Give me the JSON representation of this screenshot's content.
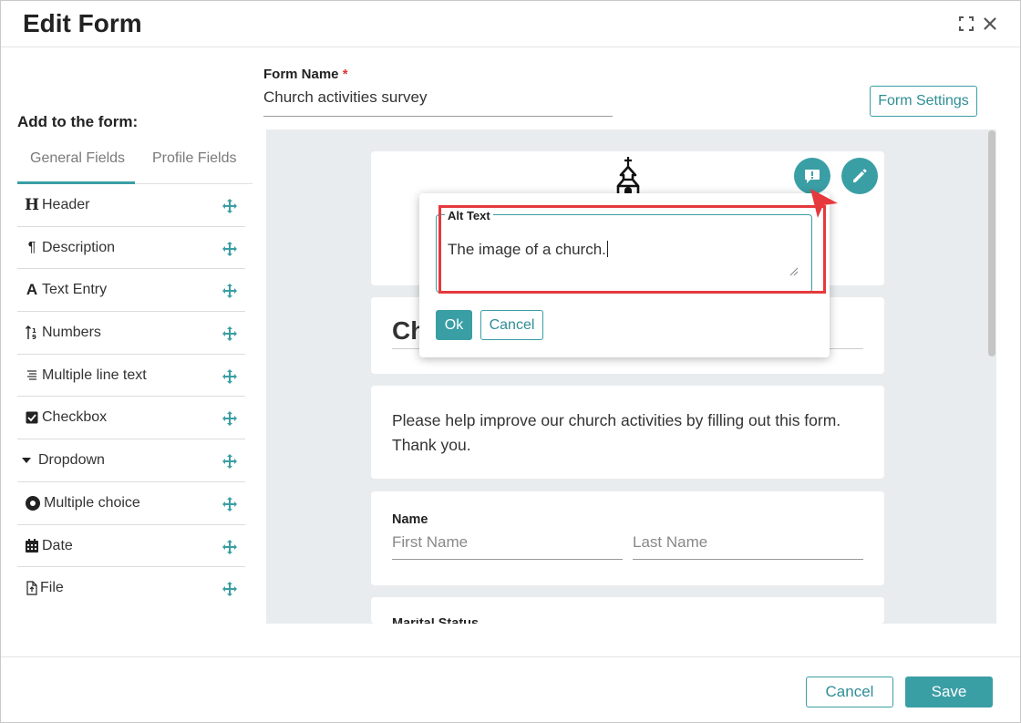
{
  "dialog": {
    "title": "Edit Form",
    "icons": {
      "fullscreen": "fullscreen-icon",
      "close": "close-icon"
    }
  },
  "sidebar": {
    "title": "Add to the form:",
    "tabs": [
      {
        "label": "General Fields",
        "active": true
      },
      {
        "label": "Profile Fields",
        "active": false
      }
    ],
    "items": [
      {
        "label": "Header",
        "icon": "header-icon"
      },
      {
        "label": "Description",
        "icon": "paragraph-icon"
      },
      {
        "label": "Text Entry",
        "icon": "text-icon"
      },
      {
        "label": "Numbers",
        "icon": "numbers-icon"
      },
      {
        "label": "Multiple line text",
        "icon": "multiline-icon"
      },
      {
        "label": "Checkbox",
        "icon": "checkbox-icon"
      },
      {
        "label": "Dropdown",
        "icon": "caret-down-icon"
      },
      {
        "label": "Multiple choice",
        "icon": "radio-icon"
      },
      {
        "label": "Date",
        "icon": "calendar-icon"
      },
      {
        "label": "File",
        "icon": "file-icon"
      }
    ]
  },
  "form": {
    "name_label": "Form Name",
    "required_mark": "*",
    "name_value": "Church activities survey",
    "settings_label": "Form Settings"
  },
  "canvas": {
    "header_text": "Ch",
    "description": "Please help improve our church activities by filling out this form. Thank you.",
    "name_field": {
      "label": "Name",
      "first_placeholder": "First Name",
      "last_placeholder": "Last Name"
    },
    "marital_label": "Marital Status"
  },
  "alt_popover": {
    "legend": "Alt Text",
    "value": "The image of a church.",
    "ok_label": "Ok",
    "cancel_label": "Cancel"
  },
  "footer": {
    "cancel_label": "Cancel",
    "save_label": "Save"
  },
  "colors": {
    "accent": "#3a9ea5",
    "annotation": "#e5393d",
    "canvas_bg": "#e9ecee"
  }
}
